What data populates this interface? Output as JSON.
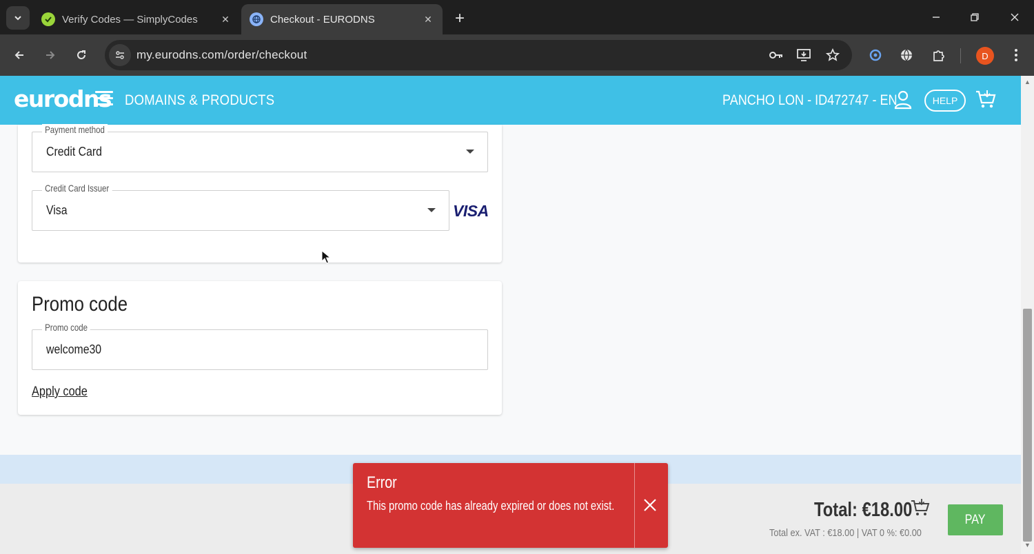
{
  "browser": {
    "tabs": [
      {
        "title": "Verify Codes — SimplyCodes",
        "active": false
      },
      {
        "title": "Checkout - EURODNS",
        "active": true
      }
    ],
    "url": "my.eurodns.com/order/checkout",
    "profile_initial": "D"
  },
  "header": {
    "logo": "eurodns",
    "nav_label": "DOMAINS & PRODUCTS",
    "account": "PANCHO LON - ID472747 - EN",
    "help_label": "HELP"
  },
  "payment": {
    "method_label": "Payment method",
    "method_value": "Credit Card",
    "issuer_label": "Credit Card Issuer",
    "issuer_value": "Visa",
    "card_brand": "VISA"
  },
  "promo": {
    "title": "Promo code",
    "field_label": "Promo code",
    "field_value": "welcome30",
    "apply_label": "Apply code"
  },
  "summary": {
    "total": "Total: €18.00",
    "vat_line": "Total ex. VAT : €18.00 | VAT 0 %: €0.00",
    "pay_label": "PAY"
  },
  "toast": {
    "title": "Error",
    "message": "This promo code has already expired or does not exist."
  },
  "colors": {
    "header_bg": "#3fc0e6",
    "error_bg": "#d33333",
    "pay_bg": "#5fb760",
    "visa_blue": "#1a1f71"
  }
}
